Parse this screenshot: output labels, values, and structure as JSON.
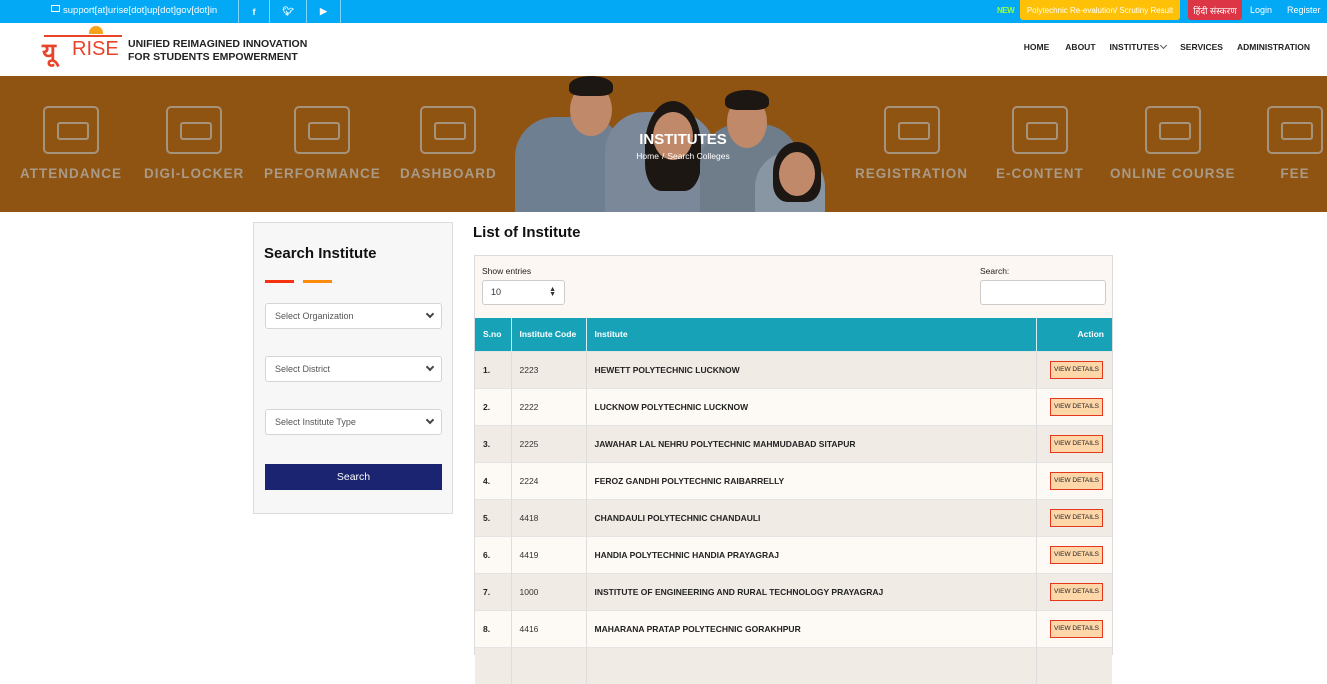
{
  "topbar": {
    "email": "support[at]urise[dot]up[dot]gov[dot]in",
    "social": [
      "facebook",
      "twitter",
      "youtube"
    ],
    "new_tag": "NEW",
    "result_link": "Polytechnic Re-evalution/ Scrutiny Result",
    "hindi_link": "हिंदी संस्करण",
    "login": "Login",
    "register": "Register",
    "colors": {
      "bar": "#03a9f4",
      "result": "#ffc107",
      "hindi": "#dc3545"
    }
  },
  "header": {
    "logo_text_hindi": "यू",
    "logo_text_rise": "RISE",
    "brand_line1": "UNIFIED REIMAGINED INNOVATION",
    "brand_line2": "FOR STUDENTS EMPOWERMENT",
    "nav": [
      "HOME",
      "ABOUT",
      "INSTITUTES",
      "SERVICES",
      "ADMINISTRATION"
    ]
  },
  "hero": {
    "title": "INSTITUTES",
    "breadcrumb": [
      "Home",
      "Search Colleges"
    ],
    "features_left": [
      "ATTENDANCE",
      "DIGI-LOCKER",
      "PERFORMANCE",
      "DASHBOARD"
    ],
    "features_right": [
      "REGISTRATION",
      "E-CONTENT",
      "ONLINE COURSE",
      "FEE"
    ]
  },
  "sidebar": {
    "title": "Search Institute",
    "organization_placeholder": "Select Organization",
    "district_placeholder": "Select District",
    "institute_type_placeholder": "Select Institute Type",
    "search_button": "Search"
  },
  "main": {
    "title": "List of Institute",
    "show_entries_label": "Show entries",
    "entries_value": "10",
    "search_label": "Search:",
    "search_value": "",
    "columns": [
      "S.no",
      "Institute Code",
      "Institute",
      "Action"
    ],
    "action_label": "VIEW DETAILS",
    "rows": [
      {
        "sno": "1.",
        "code": "2223",
        "name": "HEWETT POLYTECHNIC LUCKNOW"
      },
      {
        "sno": "2.",
        "code": "2222",
        "name": "LUCKNOW POLYTECHNIC LUCKNOW"
      },
      {
        "sno": "3.",
        "code": "2225",
        "name": "JAWAHAR LAL NEHRU POLYTECHNIC MAHMUDABAD SITAPUR"
      },
      {
        "sno": "4.",
        "code": "2224",
        "name": "FEROZ GANDHI POLYTECHNIC RAIBARRELLY"
      },
      {
        "sno": "5.",
        "code": "4418",
        "name": "CHANDAULI POLYTECHNIC CHANDAULI"
      },
      {
        "sno": "6.",
        "code": "4419",
        "name": "HANDIA POLYTECHNIC HANDIA PRAYAGRAJ"
      },
      {
        "sno": "7.",
        "code": "1000",
        "name": "INSTITUTE OF ENGINEERING AND RURAL TECHNOLOGY PRAYAGRAJ"
      },
      {
        "sno": "8.",
        "code": "4416",
        "name": "MAHARANA PRATAP POLYTECHNIC GORAKHPUR"
      },
      {
        "sno": "",
        "code": "",
        "name": ""
      }
    ]
  }
}
